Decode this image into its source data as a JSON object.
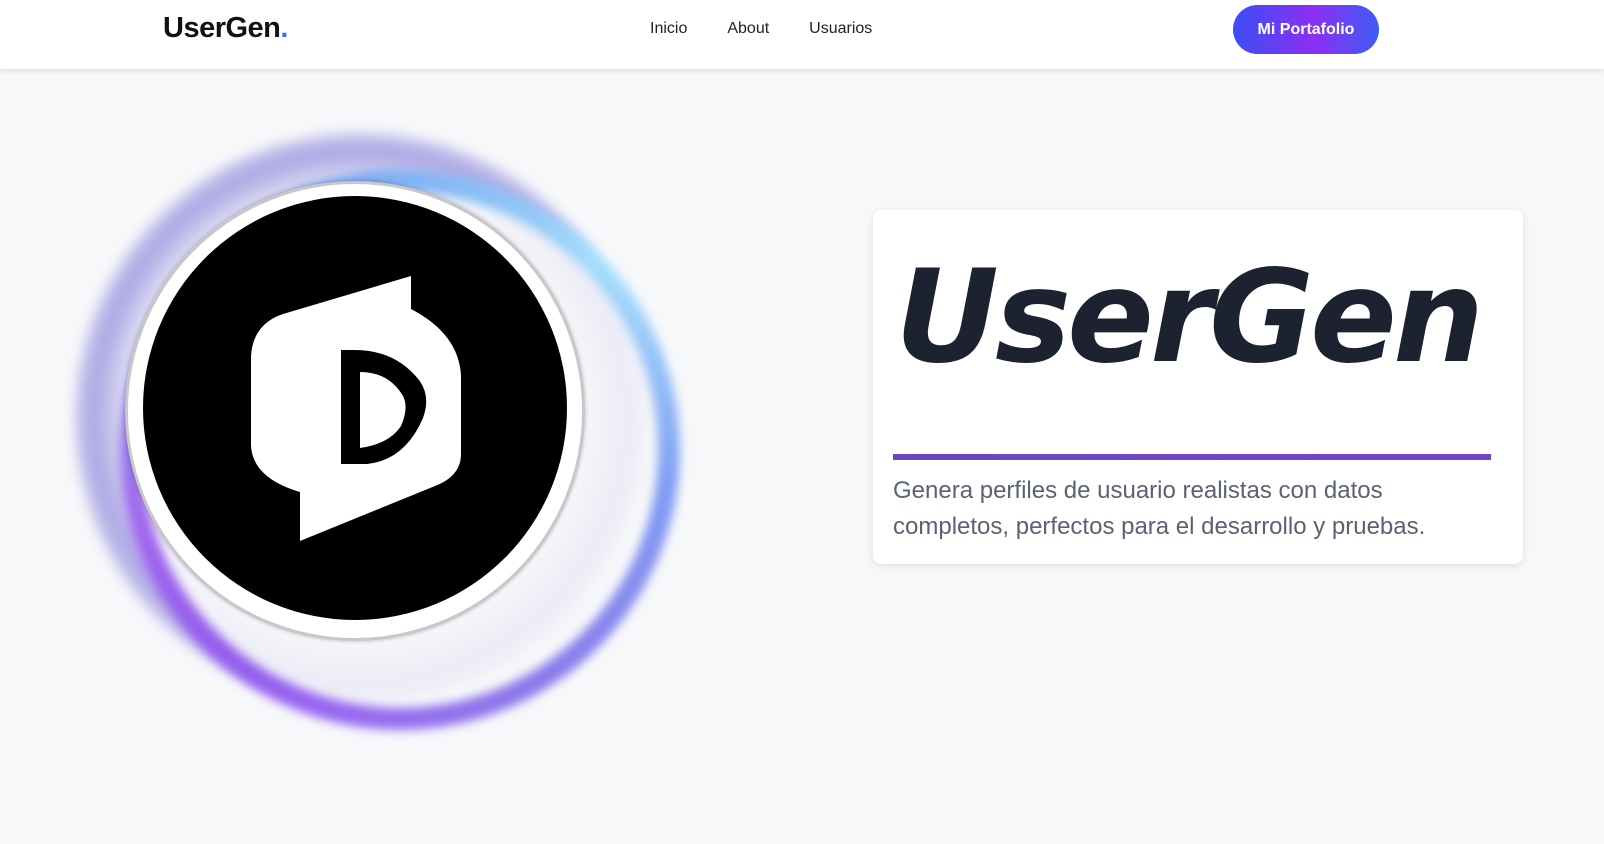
{
  "navbar": {
    "brand": "UserGen",
    "brand_dot": ".",
    "links": [
      {
        "label": "Inicio"
      },
      {
        "label": "About"
      },
      {
        "label": "Usuarios"
      }
    ],
    "cta_label": "Mi Portafolio"
  },
  "hero": {
    "logo_icon": "usergen-d-logo-icon",
    "card": {
      "title": "UserGen",
      "description": "Genera perfiles de usuario realistas con datos completos, perfectos para el desarrollo y pruebas."
    }
  },
  "colors": {
    "accent_blue": "#3b6cf6",
    "cta_gradient_start": "#3c4ef5",
    "cta_gradient_mid": "#8b2ff2",
    "divider_purple": "#6b46c1",
    "title_dark": "#1c2230",
    "description_gray": "#5a6273",
    "page_background": "#f7f8fa"
  }
}
